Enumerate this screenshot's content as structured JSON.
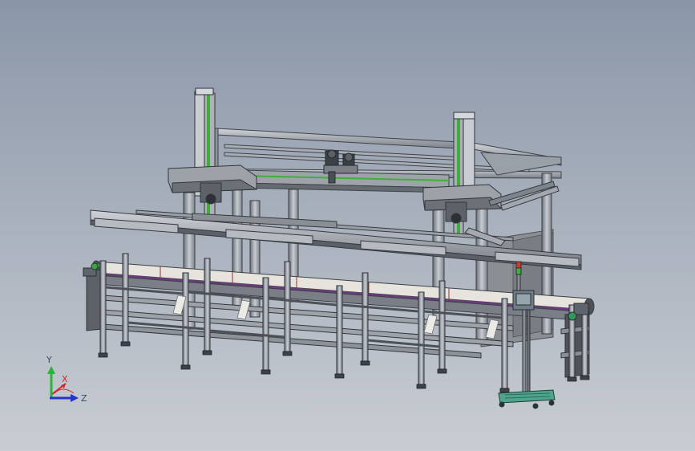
{
  "viewport": {
    "background_top": "#8a96a8",
    "background_bottom": "#c9cdd3"
  },
  "triad": {
    "y_label": "Y",
    "z_label": "Z",
    "x_label": "X",
    "colors": {
      "y": "#2db33a",
      "z": "#2435c8",
      "x": "#cc2a2a"
    }
  },
  "scene": {
    "description_icon": "conveyor-gantry-machine-model",
    "colors": {
      "frame": "#8d929a",
      "frame_dark": "#585e66",
      "frame_light": "#c6cad0",
      "accent_green": "#3fae3a",
      "belt": "#e6e4dc",
      "belt_stripe": "#6a3d7a",
      "panel": "#7c8087",
      "control_box": "#6f7d86",
      "cart": "#4ea48c"
    }
  }
}
